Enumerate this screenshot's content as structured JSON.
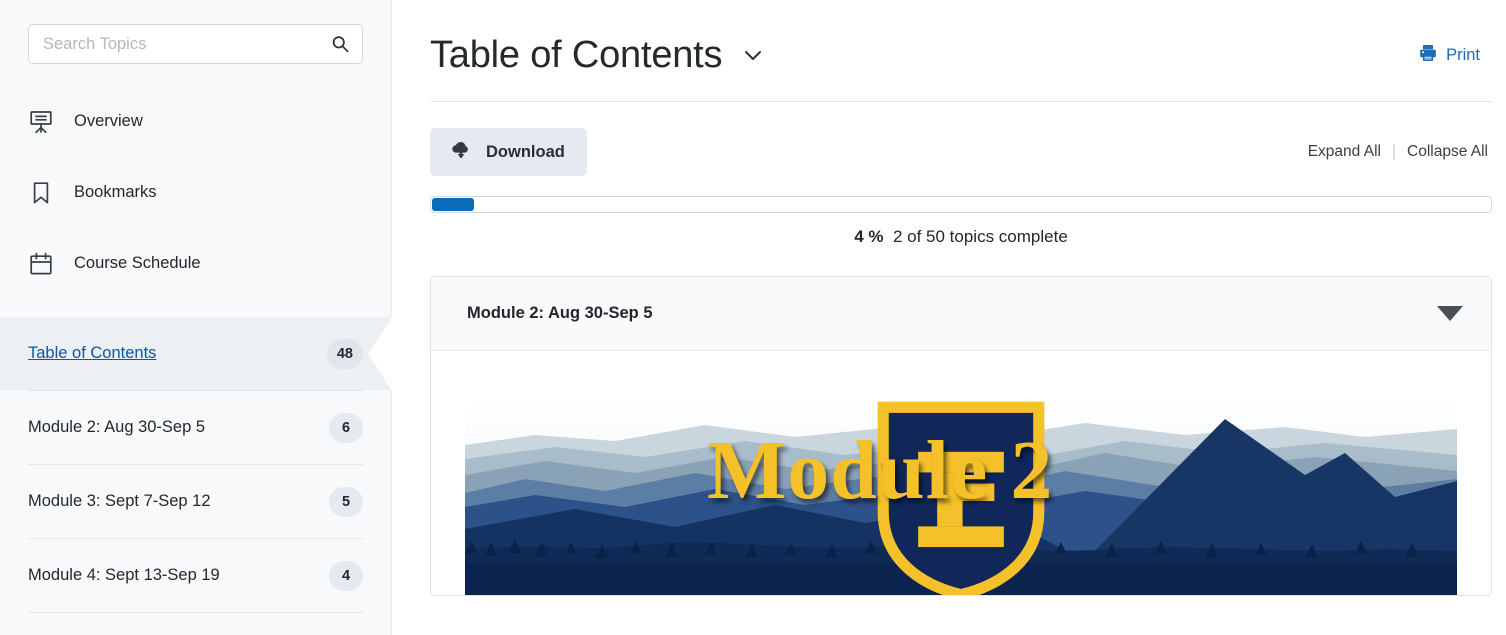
{
  "sidebar": {
    "search": {
      "placeholder": "Search Topics",
      "value": "",
      "icon": "search-icon"
    },
    "nav_items": [
      {
        "label": "Overview",
        "icon": "presentation-icon"
      },
      {
        "label": "Bookmarks",
        "icon": "bookmark-icon"
      },
      {
        "label": "Course Schedule",
        "icon": "calendar-icon"
      }
    ],
    "toc_items": [
      {
        "label": "Table of Contents",
        "count": "48",
        "active": true
      },
      {
        "label": "Module 2: Aug 30-Sep 5",
        "count": "6",
        "active": false
      },
      {
        "label": "Module 3: Sept 7-Sep 12",
        "count": "5",
        "active": false
      },
      {
        "label": "Module 4: Sept 13-Sep 19",
        "count": "4",
        "active": false
      }
    ]
  },
  "main": {
    "title": "Table of Contents",
    "title_chevron_icon": "chevron-down-icon",
    "print": {
      "label": "Print",
      "icon": "printer-icon",
      "color": "#1e6bb8"
    },
    "download": {
      "label": "Download",
      "icon": "cloud-download-icon"
    },
    "expand_all": "Expand All",
    "separator": "|",
    "collapse_all": "Collapse All",
    "progress": {
      "percent_label": "4 %",
      "status": "2 of 50 topics complete",
      "percent_value": 4,
      "fill_color": "#0a6cb8"
    },
    "module": {
      "title": "Module 2: Aug 30-Sep 5",
      "collapse_icon": "triangle-down-icon",
      "banner": {
        "heading": "Module 2",
        "logo_icon": "etsu-shield-icon",
        "logo_letter": "E",
        "gold": "#f5c12a",
        "navy": "#11275a"
      }
    }
  }
}
